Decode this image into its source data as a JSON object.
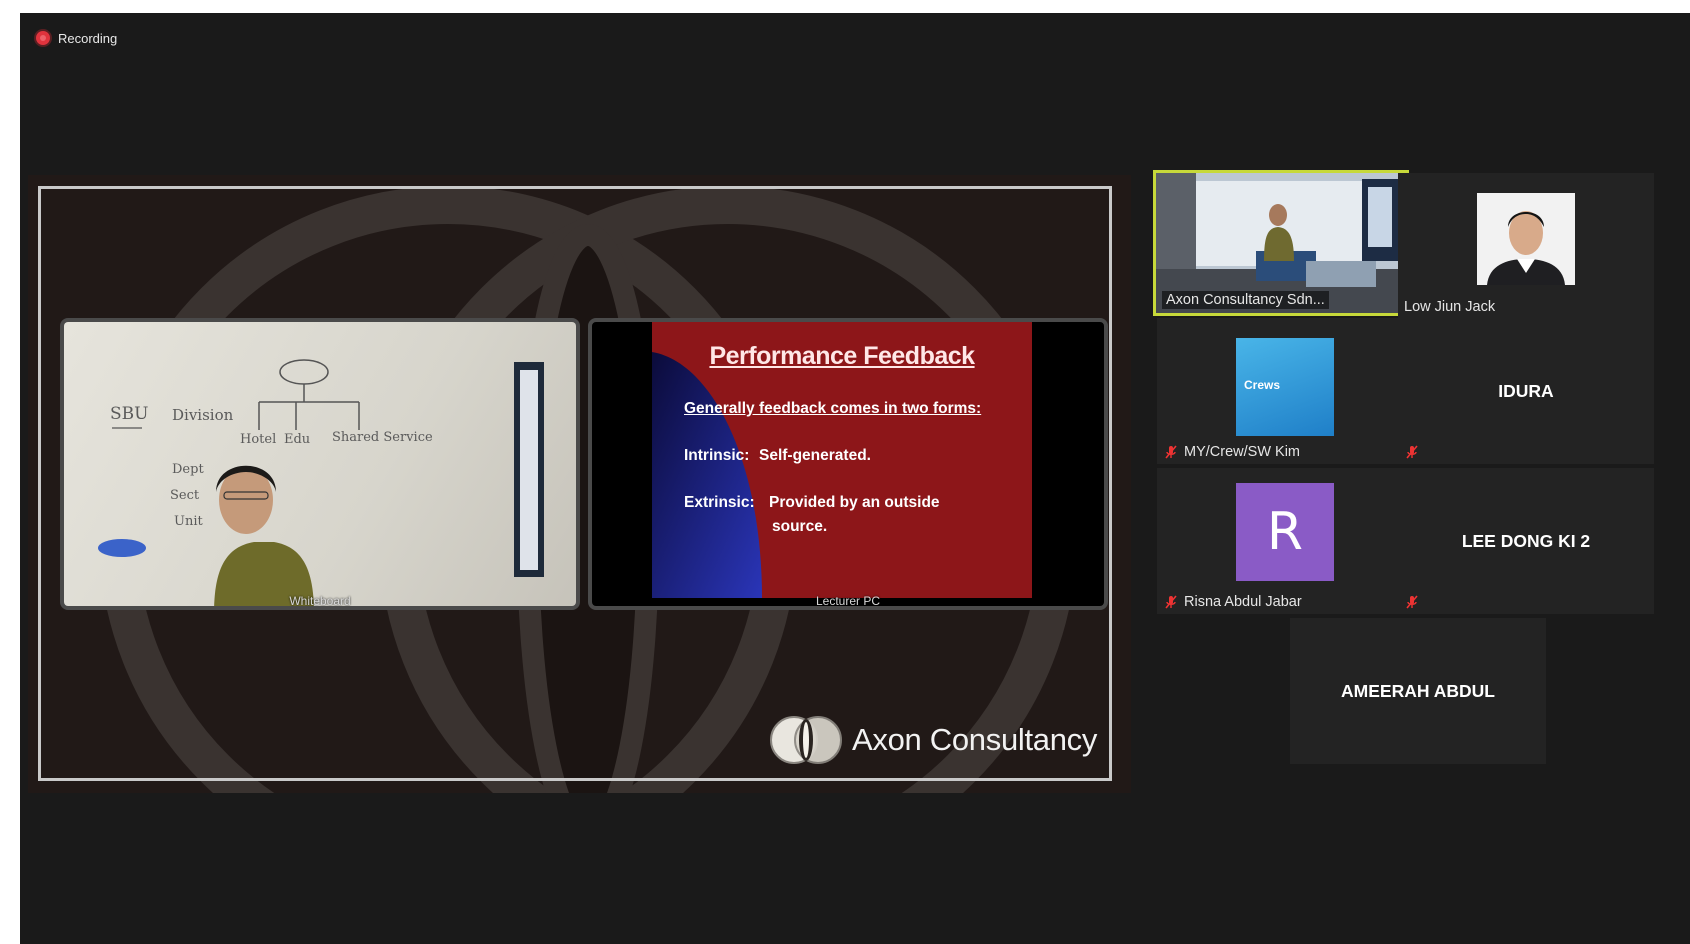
{
  "recording": {
    "label": "Recording"
  },
  "share": {
    "whiteboard_label": "Whiteboard",
    "lecturer_pc_label": "Lecturer PC",
    "whiteboard_text": {
      "sbu": "SBU",
      "division": "Division",
      "hotel": "Hotel",
      "edu": "Edu",
      "shared": "Shared Service",
      "dept": "Dept",
      "sect": "Sect",
      "unit": "Unit"
    },
    "slide": {
      "title": "Performance Feedback",
      "subtitle": "Generally feedback comes in two forms:",
      "intrinsic_label": "Intrinsic:",
      "intrinsic_text": "Self-generated.",
      "extrinsic_label": "Extrinsic:",
      "extrinsic_text_1": "Provided by an outside",
      "extrinsic_text_2": "source."
    },
    "brand": "Axon Consultancy"
  },
  "gallery": {
    "tiles": [
      {
        "name": "Axon Consultancy Sdn...",
        "muted": false,
        "active": true
      },
      {
        "name": "Low Jiun Jack",
        "muted": false
      },
      {
        "name": "MY/Crew/SW Kim",
        "muted": true,
        "thumb_text": "Crews"
      },
      {
        "name": "IDURA",
        "muted": true
      },
      {
        "name": "Risna Abdul Jabar",
        "muted": true,
        "avatar_letter": "R"
      },
      {
        "name": "LEE DONG KI 2",
        "muted": true
      },
      {
        "name": "AMEERAH ABDUL",
        "muted": false
      }
    ]
  },
  "colors": {
    "active_border": "#c7d93a",
    "avatar": "#8a5bc6",
    "slide_red": "#8d1619",
    "recording_dot": "#e0333d"
  }
}
